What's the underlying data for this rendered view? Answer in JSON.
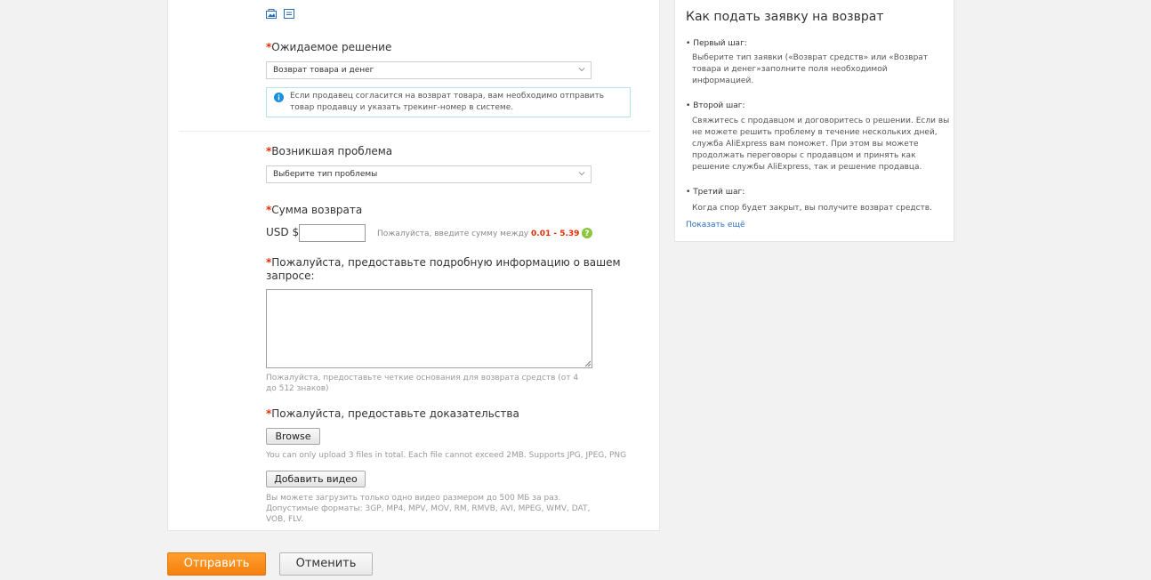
{
  "form": {
    "solution": {
      "label": "Ожидаемое решение",
      "selected": "Возврат товара и денег",
      "info": "Если продавец согласится на возврат товара, вам необходимо отправить товар продавцу и указать трекинг-номер в системе."
    },
    "problem": {
      "label": "Возникшая проблема",
      "selected": "Выберите тип проблемы"
    },
    "amount": {
      "label": "Сумма возврата",
      "currency": "USD $",
      "value": "",
      "hint_prefix": "Пожалуйста, введите сумму между",
      "hint_range": "0.01 - 5.39"
    },
    "details": {
      "label_line1": "Пожалуйста, предоставьте подробную информацию о вашем",
      "label_line2": "запросе:",
      "value": "",
      "note": "Пожалуйста, предоставьте четкие основания для возврата средств (от 4 до 512 знаков)"
    },
    "evidence": {
      "label": "Пожалуйста, предоставьте доказательства",
      "browse_label": "Browse",
      "upload_note": "You can only upload 3 files in total. Each file cannot exceed 2MB. Supports JPG, JPEG, PNG",
      "video_label": "Добавить видео",
      "video_note": "Вы можете загрузить только одно видео размером до 500 МБ за раз. Допустимые форматы: 3GP, MP4, MPV, MOV, RM, RMVB, AVI, MPEG, WMV, DAT, VOB, FLV."
    },
    "required_mark": "*"
  },
  "sidebar": {
    "title": "Как подать заявку на возврат",
    "steps": [
      {
        "title": "Первый шаг:",
        "text": "Выберите тип заявки («Возврат средств» или «Возврат товара и денег»заполните поля необходимой информацией."
      },
      {
        "title": "Второй шаг:",
        "text": "Свяжитесь с продавцом и договоритесь о решении. Если вы не можете решить проблему в течение нескольких дней, служба AliExpress вам поможет. При этом вы можете продолжать переговоры с продавцом и принять как решение службы AliExpress, так и решение продавца."
      },
      {
        "title": "Третий шаг:",
        "text": "Когда спор будет закрыт, вы получите возврат средств."
      }
    ],
    "show_more": "Показать ещё",
    "bullet": "•"
  },
  "actions": {
    "submit": "Отправить",
    "cancel": "Отменить"
  },
  "colors": {
    "required": "#e62e04",
    "submit_bg": "#f7880f",
    "link": "#2a6ebb",
    "info_icon": "#1a8fe0",
    "help_icon": "#8cc63f"
  }
}
